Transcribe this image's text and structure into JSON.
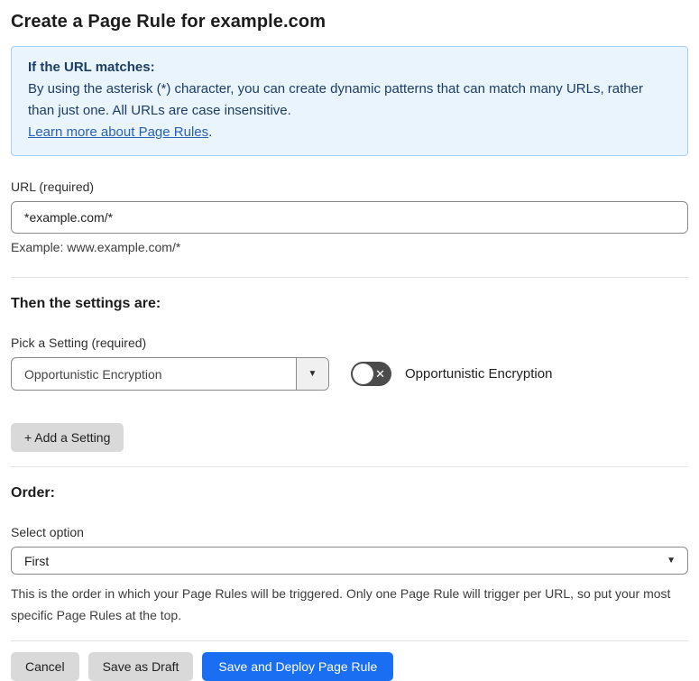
{
  "page": {
    "title": "Create a Page Rule for example.com"
  },
  "info_box": {
    "heading": "If the URL matches:",
    "body": "By using the asterisk (*) character, you can create dynamic patterns that can match many URLs, rather than just one. All URLs are case insensitive.",
    "link_label": "Learn more about Page Rules",
    "link_suffix": "."
  },
  "url_field": {
    "label": "URL (required)",
    "value": "*example.com/*",
    "helper": "Example: www.example.com/*"
  },
  "settings_section": {
    "heading": "Then the settings are:",
    "picker_label": "Pick a Setting (required)",
    "picker_value": "Opportunistic Encryption",
    "toggle_state": "off",
    "toggle_off_glyph": "✕",
    "toggle_label": "Opportunistic Encryption",
    "add_setting_label": "+ Add a Setting",
    "chevron_glyph": "▼"
  },
  "order_section": {
    "heading": "Order:",
    "select_label": "Select option",
    "select_value": "First",
    "chevron_glyph": "▼",
    "helper": "This is the order in which your Page Rules will be triggered. Only one Page Rule will trigger per URL, so put your most specific Page Rules at the top."
  },
  "actions": {
    "cancel": "Cancel",
    "save_draft": "Save as Draft",
    "save_deploy": "Save and Deploy Page Rule"
  },
  "colors": {
    "accent_blue": "#1a6ef2",
    "info_bg": "#eaf4fc",
    "info_border": "#a9d2f1",
    "info_text": "#1d3d66",
    "link_blue": "#2862b5",
    "toggle_off_bg": "#4b4b4b",
    "button_gray": "#d9d9d9"
  }
}
